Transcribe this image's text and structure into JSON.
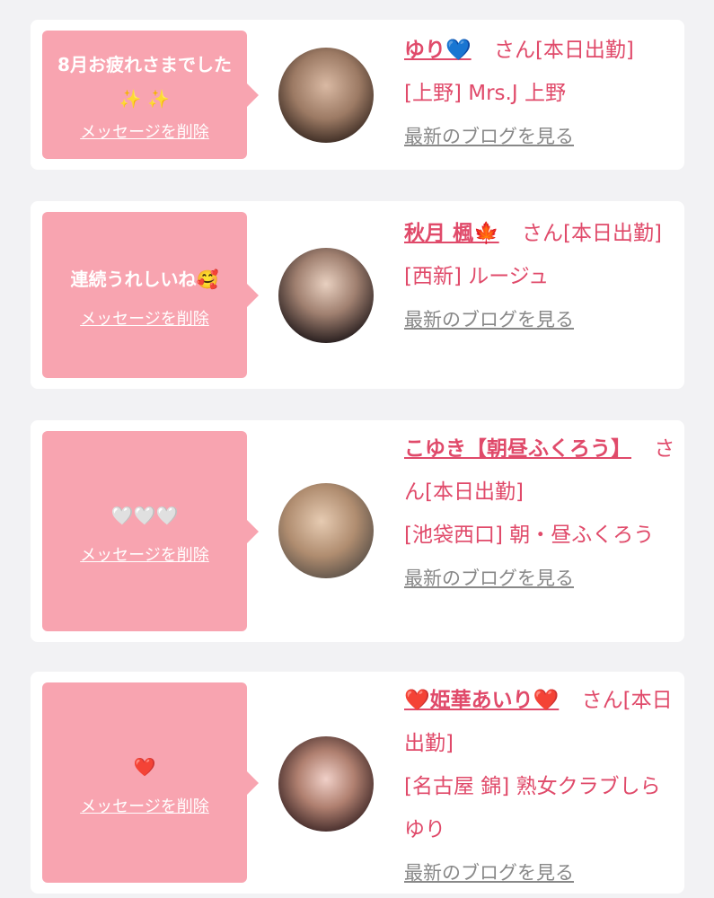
{
  "delete_label": "メッセージを削除",
  "blog_link_label": "最新のブログを見る",
  "colors": {
    "accent": "#e04a6a",
    "bubble": "#f8a4b0",
    "background": "#f2f2f4"
  },
  "items": [
    {
      "message": "8月お疲れさまでした",
      "message_emoji": "✨ ✨",
      "name": "ゆり💙",
      "suffix": "さん[本日出勤]",
      "shop": "[上野] Mrs.J 上野"
    },
    {
      "message": "連続うれしいね",
      "message_emoji": "🥰",
      "name": "秋月 楓🍁",
      "suffix": "さん[本日出勤]",
      "shop": "[西新] ルージュ"
    },
    {
      "message": "",
      "message_emoji": "🤍🤍🤍",
      "name": "こゆき【朝昼ふくろう】",
      "suffix": "さん[本日出勤]",
      "shop": "[池袋西口] 朝・昼ふくろう"
    },
    {
      "message": "",
      "message_emoji": "❤️",
      "name": "❤️姫華あいり❤️",
      "suffix": "さん[本日出勤]",
      "shop": "[名古屋 錦] 熟女クラブしらゆり"
    }
  ]
}
